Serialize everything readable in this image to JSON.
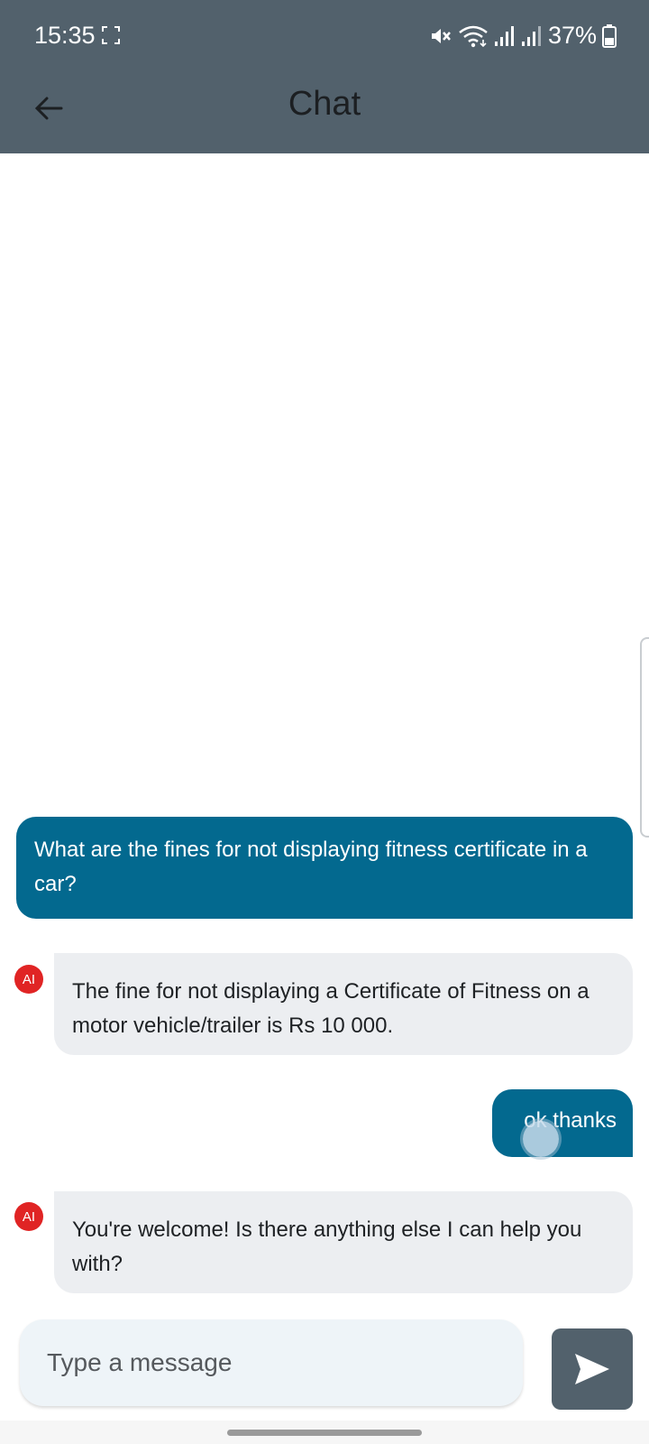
{
  "status_bar": {
    "time": "15:35",
    "battery": "37%",
    "icons": [
      "screenshot-frame-icon",
      "mute-icon",
      "wifi-icon",
      "signal-icon",
      "signal-icon",
      "battery-icon"
    ]
  },
  "app_bar": {
    "title": "Chat",
    "back_icon": "arrow-left-icon"
  },
  "messages": [
    {
      "sender": "user",
      "text": "What are the fines for not displaying fitness certificate in a car?"
    },
    {
      "sender": "ai",
      "avatar": "AI",
      "text": "The fine for not displaying a Certificate of Fitness on a motor vehicle/trailer is Rs 10 000."
    },
    {
      "sender": "user",
      "text": "ok thanks"
    },
    {
      "sender": "ai",
      "avatar": "AI",
      "text": "You're welcome! Is there anything else I can help you with?"
    }
  ],
  "composer": {
    "placeholder": "Type a message",
    "send_icon": "send-icon"
  },
  "colors": {
    "app_bar": "#52616c",
    "user_bubble": "#03698f",
    "ai_bubble": "#eceef1",
    "avatar": "#e02424"
  }
}
